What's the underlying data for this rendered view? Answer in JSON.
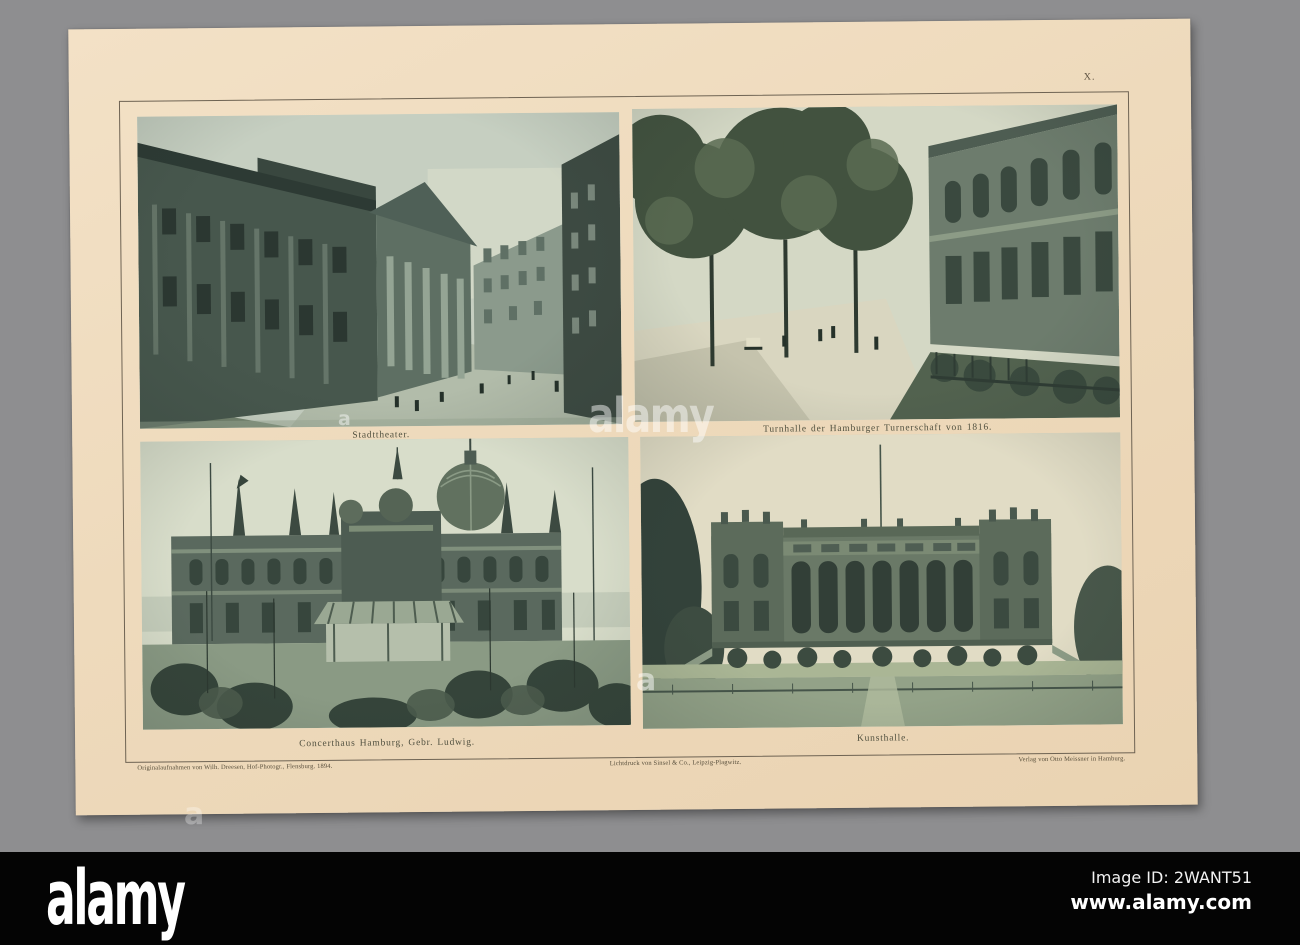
{
  "plate_number": "X.",
  "photos": [
    {
      "name": "stadttheater",
      "caption": "Stadttheater."
    },
    {
      "name": "turnhalle",
      "caption": "Turnhalle der Hamburger Turnerschaft von 1816."
    },
    {
      "name": "concerthaus",
      "caption": "Concerthaus Hamburg, Gebr. Ludwig."
    },
    {
      "name": "kunsthalle",
      "caption": "Kunsthalle."
    }
  ],
  "imprint": {
    "photographer": "Originalaufnahmen von Wilh. Dreesen, Hof-Photogr., Flensburg. 1894.",
    "printer": "Lichtdruck von Sinsel & Co., Leipzig-Plagwitz.",
    "publisher": "Verlag von Otto Meissner in Hamburg."
  },
  "watermark": {
    "brand": "alamy",
    "letter": "a"
  },
  "footer": {
    "logo": "alamy",
    "image_id": "Image ID: 2WANT51",
    "url": "www.alamy.com"
  },
  "colors": {
    "background_gray": "#8e8e90",
    "paper": "#eedabc",
    "frame_line": "#6e6353",
    "caption_text": "#50503f",
    "photo_dark": "#33413a",
    "photo_light": "#ccd5c6",
    "footer_bar": "#040404",
    "footer_text": "#ffffff"
  }
}
